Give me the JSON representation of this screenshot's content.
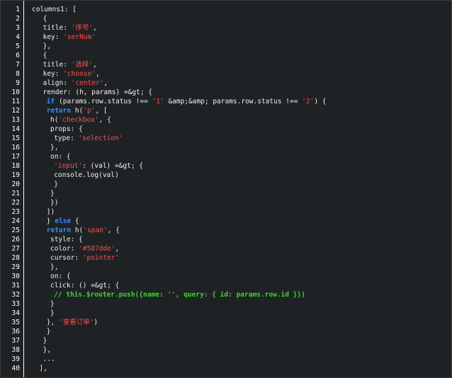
{
  "editor": {
    "theme": {
      "background": "#1f2224",
      "text": "#f0f0f0",
      "string": "#ff4d4d",
      "keyword": "#3d8cff",
      "comment": "#39d82a"
    },
    "lines": [
      {
        "n": "1",
        "indent": 0,
        "tokens": [
          {
            "t": "plain",
            "v": "columns1: ["
          }
        ]
      },
      {
        "n": "2",
        "indent": 3,
        "tokens": [
          {
            "t": "plain",
            "v": "{"
          }
        ]
      },
      {
        "n": "3",
        "indent": 3,
        "tokens": [
          {
            "t": "plain",
            "v": "title: "
          },
          {
            "t": "str",
            "v": "'序号'"
          },
          {
            "t": "plain",
            "v": ","
          }
        ]
      },
      {
        "n": "4",
        "indent": 3,
        "tokens": [
          {
            "t": "plain",
            "v": "key: "
          },
          {
            "t": "str",
            "v": "'serNum'"
          }
        ]
      },
      {
        "n": "5",
        "indent": 3,
        "tokens": [
          {
            "t": "plain",
            "v": "},"
          }
        ]
      },
      {
        "n": "6",
        "indent": 3,
        "tokens": [
          {
            "t": "plain",
            "v": "{"
          }
        ]
      },
      {
        "n": "7",
        "indent": 3,
        "tokens": [
          {
            "t": "plain",
            "v": "title: "
          },
          {
            "t": "str",
            "v": "'选择'"
          },
          {
            "t": "plain",
            "v": ","
          }
        ]
      },
      {
        "n": "8",
        "indent": 3,
        "tokens": [
          {
            "t": "plain",
            "v": "key: "
          },
          {
            "t": "str",
            "v": "'choose'"
          },
          {
            "t": "plain",
            "v": ","
          }
        ]
      },
      {
        "n": "9",
        "indent": 3,
        "tokens": [
          {
            "t": "plain",
            "v": "align: "
          },
          {
            "t": "str",
            "v": "'center'"
          },
          {
            "t": "plain",
            "v": ","
          }
        ]
      },
      {
        "n": "10",
        "indent": 3,
        "tokens": [
          {
            "t": "plain",
            "v": "render: (h, params) =&gt; {"
          }
        ]
      },
      {
        "n": "11",
        "indent": 4,
        "tokens": [
          {
            "t": "kw",
            "v": "if"
          },
          {
            "t": "plain",
            "v": " (params.row.status !== "
          },
          {
            "t": "str",
            "v": "'1'"
          },
          {
            "t": "plain",
            "v": " &amp;&amp; params.row.status !== "
          },
          {
            "t": "str",
            "v": "'2'"
          },
          {
            "t": "plain",
            "v": ") {"
          }
        ]
      },
      {
        "n": "12",
        "indent": 4,
        "tokens": [
          {
            "t": "kw",
            "v": "return"
          },
          {
            "t": "plain",
            "v": " h("
          },
          {
            "t": "str",
            "v": "'p'"
          },
          {
            "t": "plain",
            "v": ", ["
          }
        ]
      },
      {
        "n": "13",
        "indent": 5,
        "tokens": [
          {
            "t": "plain",
            "v": "h("
          },
          {
            "t": "str",
            "v": "'checkbox'"
          },
          {
            "t": "plain",
            "v": ", {"
          }
        ]
      },
      {
        "n": "14",
        "indent": 5,
        "tokens": [
          {
            "t": "plain",
            "v": "props: {"
          }
        ]
      },
      {
        "n": "15",
        "indent": 6,
        "tokens": [
          {
            "t": "plain",
            "v": "type: "
          },
          {
            "t": "str",
            "v": "'selection'"
          }
        ]
      },
      {
        "n": "16",
        "indent": 5,
        "tokens": [
          {
            "t": "plain",
            "v": "},"
          }
        ]
      },
      {
        "n": "17",
        "indent": 5,
        "tokens": [
          {
            "t": "plain",
            "v": "on: {"
          }
        ]
      },
      {
        "n": "18",
        "indent": 6,
        "tokens": [
          {
            "t": "str",
            "v": "'input'"
          },
          {
            "t": "plain",
            "v": ": (val) =&gt; {"
          }
        ]
      },
      {
        "n": "19",
        "indent": 6,
        "tokens": [
          {
            "t": "plain",
            "v": "console.log(val)"
          }
        ]
      },
      {
        "n": "20",
        "indent": 6,
        "tokens": [
          {
            "t": "plain",
            "v": "}"
          }
        ]
      },
      {
        "n": "21",
        "indent": 5,
        "tokens": [
          {
            "t": "plain",
            "v": "}"
          }
        ]
      },
      {
        "n": "22",
        "indent": 5,
        "tokens": [
          {
            "t": "plain",
            "v": "})"
          }
        ]
      },
      {
        "n": "23",
        "indent": 4,
        "tokens": [
          {
            "t": "plain",
            "v": "])"
          }
        ]
      },
      {
        "n": "24",
        "indent": 4,
        "tokens": [
          {
            "t": "plain",
            "v": "} "
          },
          {
            "t": "kw",
            "v": "else"
          },
          {
            "t": "plain",
            "v": " {"
          }
        ]
      },
      {
        "n": "25",
        "indent": 4,
        "tokens": [
          {
            "t": "kw",
            "v": "return"
          },
          {
            "t": "plain",
            "v": " h("
          },
          {
            "t": "str",
            "v": "'span'"
          },
          {
            "t": "plain",
            "v": ", {"
          }
        ]
      },
      {
        "n": "26",
        "indent": 5,
        "tokens": [
          {
            "t": "plain",
            "v": "style: {"
          }
        ]
      },
      {
        "n": "27",
        "indent": 5,
        "tokens": [
          {
            "t": "plain",
            "v": "color: "
          },
          {
            "t": "str",
            "v": "'#587dde'"
          },
          {
            "t": "plain",
            "v": ","
          }
        ]
      },
      {
        "n": "28",
        "indent": 5,
        "tokens": [
          {
            "t": "plain",
            "v": "cursor: "
          },
          {
            "t": "str",
            "v": "'pointer'"
          }
        ]
      },
      {
        "n": "29",
        "indent": 5,
        "tokens": [
          {
            "t": "plain",
            "v": "},"
          }
        ]
      },
      {
        "n": "30",
        "indent": 5,
        "tokens": [
          {
            "t": "plain",
            "v": "on: {"
          }
        ]
      },
      {
        "n": "31",
        "indent": 5,
        "tokens": [
          {
            "t": "plain",
            "v": "click: () =&gt; {"
          }
        ]
      },
      {
        "n": "32",
        "indent": 6,
        "tokens": [
          {
            "t": "cm",
            "v": "// this.$router.push({name: '', query: { id: params.row.id }})"
          }
        ]
      },
      {
        "n": "33",
        "indent": 5,
        "tokens": [
          {
            "t": "plain",
            "v": "}"
          }
        ]
      },
      {
        "n": "34",
        "indent": 5,
        "tokens": [
          {
            "t": "plain",
            "v": "}"
          }
        ]
      },
      {
        "n": "35",
        "indent": 4,
        "tokens": [
          {
            "t": "plain",
            "v": "}, "
          },
          {
            "t": "str",
            "v": "'查看订单'"
          },
          {
            "t": "plain",
            "v": ")"
          }
        ]
      },
      {
        "n": "36",
        "indent": 4,
        "tokens": [
          {
            "t": "plain",
            "v": "}"
          }
        ]
      },
      {
        "n": "37",
        "indent": 3,
        "tokens": [
          {
            "t": "plain",
            "v": "}"
          }
        ]
      },
      {
        "n": "38",
        "indent": 3,
        "tokens": [
          {
            "t": "plain",
            "v": "},"
          }
        ]
      },
      {
        "n": "39",
        "indent": 3,
        "tokens": [
          {
            "t": "plain",
            "v": "..."
          }
        ]
      },
      {
        "n": "40",
        "indent": 2,
        "tokens": [
          {
            "t": "plain",
            "v": "],"
          }
        ]
      }
    ]
  }
}
